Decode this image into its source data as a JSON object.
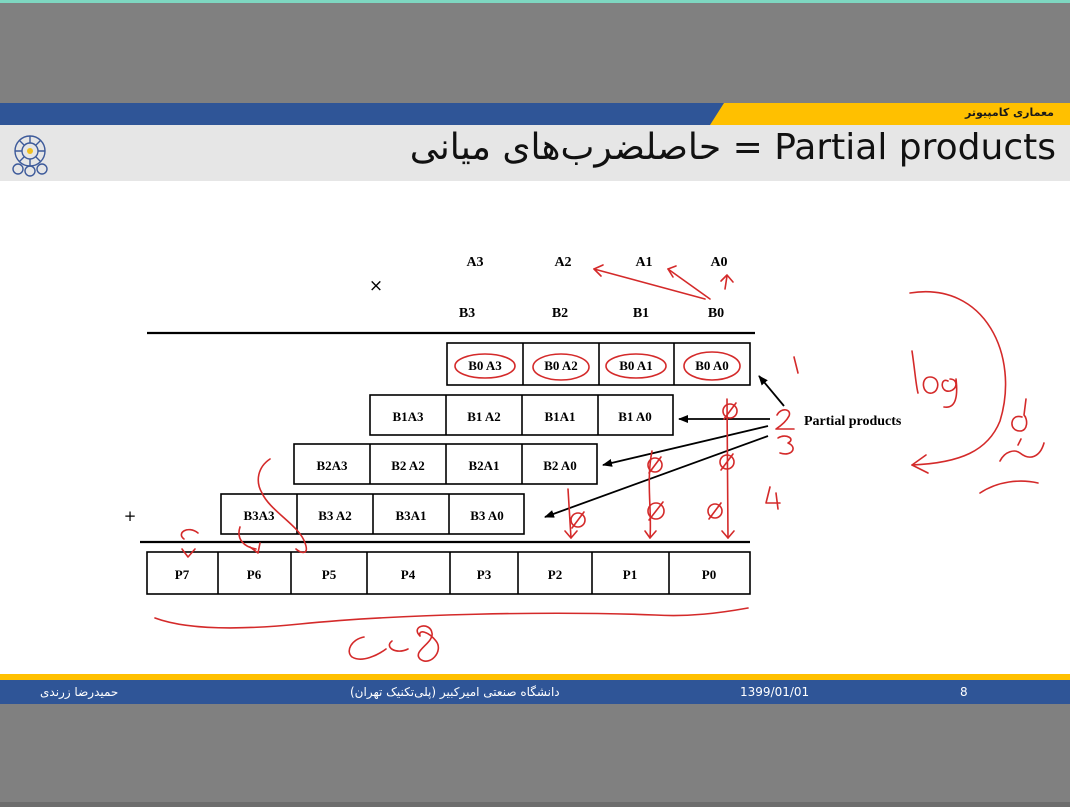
{
  "header": {
    "course": "معماری کامپیوتر",
    "title": "حاصلضرب‌های میانی = Partial products"
  },
  "diagram": {
    "multiplicand": [
      "A3",
      "A2",
      "A1",
      "A0"
    ],
    "multiplier": [
      "B3",
      "B2",
      "B1",
      "B0"
    ],
    "times_sign": "×",
    "plus_sign": "+",
    "rows": [
      [
        "B0 A3",
        "B0 A2",
        "B0 A1",
        "B0 A0"
      ],
      [
        "B1A3",
        "B1 A2",
        "B1A1",
        "B1 A0"
      ],
      [
        "B2A3",
        "B2 A2",
        "B2A1",
        "B2 A0"
      ],
      [
        "B3A3",
        "B3 A2",
        "B3A1",
        "B3 A0"
      ]
    ],
    "products": [
      "P7",
      "P6",
      "P5",
      "P4",
      "P3",
      "P2",
      "P1",
      "P0"
    ],
    "annotation_label": "Partial products"
  },
  "handwriting": {
    "numbers": [
      "1",
      "2",
      "3",
      "4"
    ],
    "log_note": "log",
    "d_note": "d",
    "delay_note": "تأخیر",
    "bits_note": "8 بیت"
  },
  "footer": {
    "author": "حمیدرضا زرندی",
    "university": "دانشگاه صنعتی امیرکبیر (پلی‌تکنیک تهران)",
    "date": "1399/01/01",
    "page": "8"
  },
  "colors": {
    "brand_blue": "#2f5597",
    "accent_yellow": "#ffc000",
    "ink_red": "#d42a2a"
  }
}
